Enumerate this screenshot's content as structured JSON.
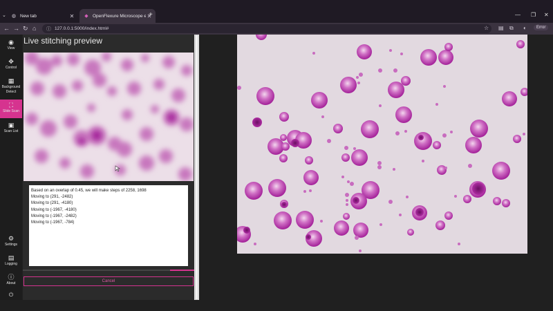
{
  "browser": {
    "tabs": [
      {
        "title": "New tab",
        "icon": "globe-icon"
      },
      {
        "title": "OpenFlexure Microscope eee…",
        "icon": "openflexure-icon"
      }
    ],
    "url": "127.0.0.1:5000/index.html#",
    "error_badge": "Error"
  },
  "sidebar": {
    "items": [
      {
        "label": "View",
        "icon": "eye-icon"
      },
      {
        "label": "Control",
        "icon": "move-arrows-icon"
      },
      {
        "label": "Background Detect",
        "icon": "grid-icon"
      },
      {
        "label": "Slide Scan",
        "icon": "scan-icon"
      },
      {
        "label": "Scan List",
        "icon": "images-icon"
      },
      {
        "label": "Settings",
        "icon": "gear-icon"
      },
      {
        "label": "Logging",
        "icon": "log-icon"
      },
      {
        "label": "About",
        "icon": "info-icon"
      }
    ],
    "active": "Slide Scan"
  },
  "panel": {
    "title": "Live stitching preview",
    "log_lines": [
      "Based on an overlap of 0.45, we will make steps of 2258, 1698",
      "Moving to (291, -2482)",
      "Moving to (291, -4180)",
      "Moving to (-1967, -4180)",
      "Moving to (-1967, -2482)",
      "Moving to (-1967, -784)"
    ],
    "progress_percent": 14,
    "cancel_label": "Cancel"
  },
  "colors": {
    "accent": "#d6338f",
    "cell": "#b02aa8",
    "background": "#e2d9e0"
  }
}
